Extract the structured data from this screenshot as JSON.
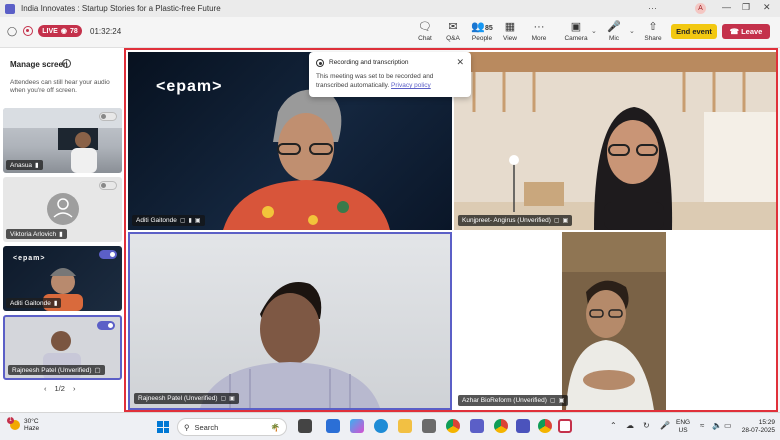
{
  "window": {
    "title": "India Innovates : Startup Stories for a Plastic-free Future",
    "more": "···",
    "user_initial": "A"
  },
  "toolbar": {
    "live_label": "LIVE",
    "viewer_count": "78",
    "timer": "01:32:24",
    "chat": "Chat",
    "qa": "Q&A",
    "people": "People",
    "people_count": "85",
    "view": "View",
    "more": "More",
    "camera": "Camera",
    "mic": "Mic",
    "share": "Share",
    "end_event": "End event",
    "leave": "Leave"
  },
  "panel": {
    "title": "Manage screen",
    "description": "Attendees can still hear your audio when you're off screen.",
    "tiles": [
      {
        "name": "Anasua",
        "toggle_on": false
      },
      {
        "name": "Viktoria Arlovich",
        "toggle_on": false
      },
      {
        "name": "Aditi Gaitonde",
        "toggle_on": true
      },
      {
        "name": "Rajneesh Patel (Unverified)",
        "toggle_on": true
      }
    ],
    "pager": "1/2"
  },
  "stage": {
    "videos": [
      {
        "name": "Aditi Gaitonde"
      },
      {
        "name": "Kunjpreet- Angirus (Unverified)"
      },
      {
        "name": "Rajneesh Patel (Unverified)"
      },
      {
        "name": "Azhar BioReform (Unverified)"
      }
    ],
    "logo_text": "<epam>"
  },
  "toast": {
    "title": "Recording and transcription",
    "body": "This meeting was set to be recorded and transcribed automatically.",
    "link": "Privacy policy"
  },
  "taskbar": {
    "weather_temp": "30°C",
    "weather_desc": "Haze",
    "weather_badge": "1",
    "search_placeholder": "Search",
    "lang_1": "ENG",
    "lang_2": "US",
    "time": "15:29",
    "date": "28-07-2025"
  },
  "colors": {
    "accent": "#5b5fc7",
    "live": "#c4314b",
    "end_event": "#f2c811",
    "stage_border": "#e0303a"
  }
}
